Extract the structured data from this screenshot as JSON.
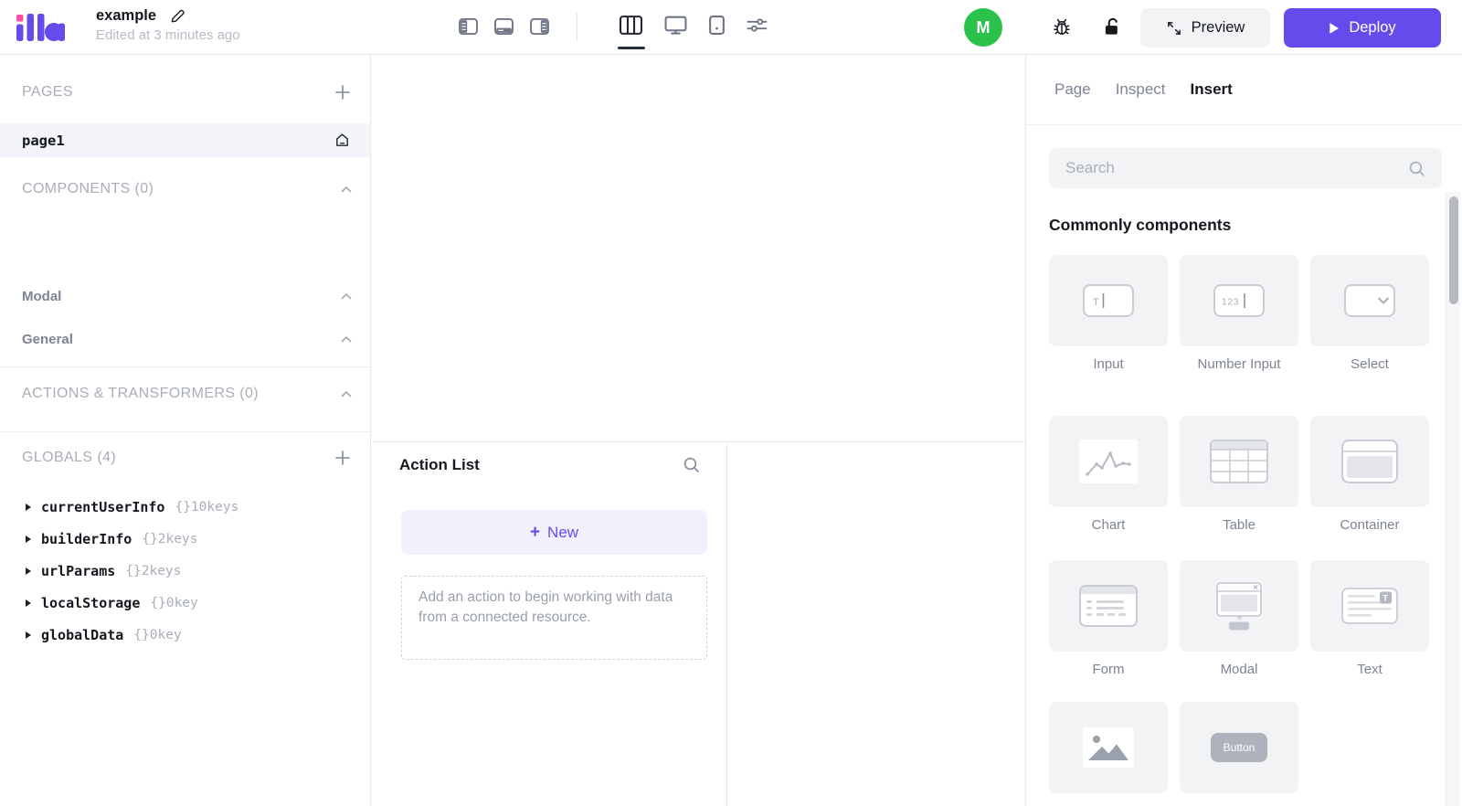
{
  "topbar": {
    "app_name": "illa",
    "title": "example",
    "edited": "Edited at 3 minutes ago",
    "avatar_letter": "M",
    "preview_label": "Preview",
    "deploy_label": "Deploy"
  },
  "sidebar": {
    "pages_header": "PAGES",
    "page1": "page1",
    "components_header": "COMPONENTS (0)",
    "modal_group": "Modal",
    "general_group": "General",
    "actions_header": "ACTIONS & TRANSFORMERS (0)",
    "globals_header": "GLOBALS (4)",
    "globals": [
      {
        "name": "currentUserInfo",
        "keys": "{}10keys"
      },
      {
        "name": "builderInfo",
        "keys": "{}2keys"
      },
      {
        "name": "urlParams",
        "keys": "{}2keys"
      },
      {
        "name": "localStorage",
        "keys": "{}0key"
      },
      {
        "name": "globalData",
        "keys": "{}0key"
      }
    ]
  },
  "action_panel": {
    "title": "Action List",
    "new_plus": "+",
    "new_label": "New",
    "empty_hint": "Add an action to begin working with data from a connected resource."
  },
  "insert_panel": {
    "tabs": [
      {
        "label": "Page"
      },
      {
        "label": "Inspect"
      },
      {
        "label": "Insert"
      }
    ],
    "active_tab": "Insert",
    "search_placeholder": "Search",
    "section_title": "Commonly components",
    "input_glyph_text": "T",
    "number_glyph_text": "123",
    "text_glyph_text": "T",
    "button_glyph_text": "Button",
    "components": [
      {
        "label": "Input"
      },
      {
        "label": "Number Input"
      },
      {
        "label": "Select"
      },
      {
        "label": "Chart"
      },
      {
        "label": "Table"
      },
      {
        "label": "Container"
      },
      {
        "label": "Form"
      },
      {
        "label": "Modal"
      },
      {
        "label": "Text"
      },
      {
        "label": ""
      },
      {
        "label": ""
      }
    ]
  },
  "colors": {
    "accent_purple": "#654aec",
    "logo_pink": "#fb4fa5",
    "avatar_green": "#2bc24c",
    "selected_row_bg": "#f4f4fb",
    "new_button_bg": "#f2f0fd",
    "card_bg": "#f2f3f5"
  }
}
